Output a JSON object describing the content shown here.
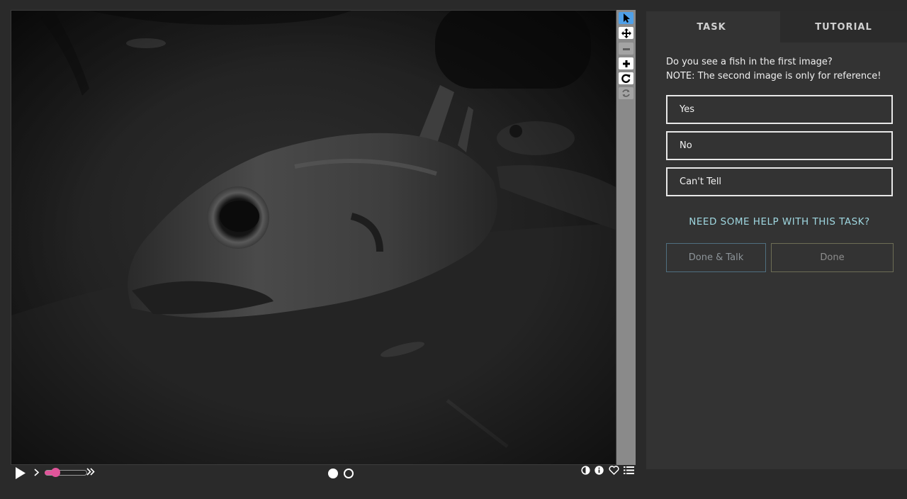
{
  "viewer": {
    "tools": [
      {
        "name": "pointer-tool",
        "icon": "pointer-icon",
        "state": "active"
      },
      {
        "name": "pan-tool",
        "icon": "move-icon",
        "state": "normal"
      },
      {
        "name": "zoom-out-tool",
        "icon": "minus-icon",
        "state": "disabled"
      },
      {
        "name": "zoom-in-tool",
        "icon": "plus-icon",
        "state": "normal"
      },
      {
        "name": "rotate-tool",
        "icon": "rotate-icon",
        "state": "normal"
      },
      {
        "name": "reset-tool",
        "icon": "refresh-icon",
        "state": "disabled"
      }
    ],
    "image_subject": "underwater-fish-photo"
  },
  "controls": {
    "play_icon": "play-icon",
    "slower_icon": "chevron-right-icon",
    "faster_icon": "double-chevron-right-icon",
    "speed_level": 0.2,
    "frames": [
      {
        "state": "current"
      },
      {
        "state": "other"
      }
    ],
    "right_icons": [
      "invert-icon",
      "info-icon",
      "heart-icon",
      "collections-icon"
    ]
  },
  "panel": {
    "tabs": {
      "task": "TASK",
      "tutorial": "TUTORIAL"
    },
    "question_line1": "Do you see a fish in the first image?",
    "question_line2": "NOTE: The second image is only for reference!",
    "answers": [
      "Yes",
      "No",
      "Can't Tell"
    ],
    "help_link": "NEED SOME HELP WITH THIS TASK?",
    "done_talk": "Done & Talk",
    "done": "Done"
  },
  "colors": {
    "page_bg": "#2a2a2a",
    "panel_bg": "#333333",
    "active_tool": "#4fa0e8",
    "help_link": "#9fd7e0",
    "speed_accent": "#e0559a"
  }
}
